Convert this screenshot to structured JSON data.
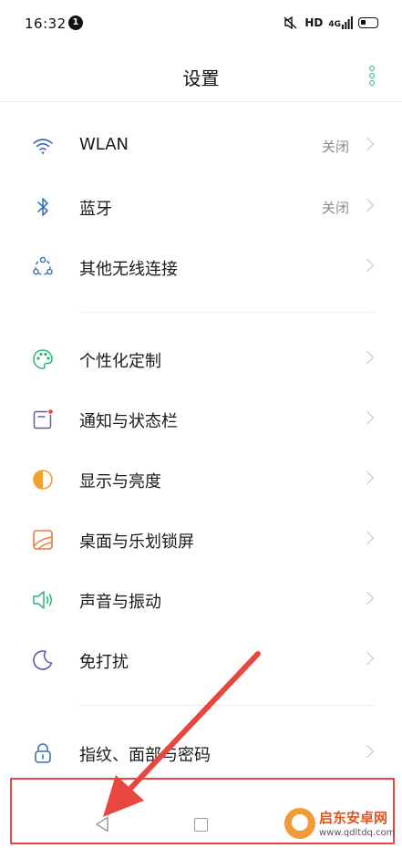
{
  "status_bar": {
    "time": "16:32",
    "notification_count": "1",
    "hd": "HD",
    "network": "4G"
  },
  "header": {
    "title": "设置"
  },
  "groups": [
    {
      "items": [
        {
          "label": "WLAN",
          "value": "关闭",
          "icon": "wifi-icon"
        },
        {
          "label": "蓝牙",
          "value": "关闭",
          "icon": "bluetooth-icon"
        },
        {
          "label": "其他无线连接",
          "value": "",
          "icon": "wireless-connections-icon"
        }
      ]
    },
    {
      "items": [
        {
          "label": "个性化定制",
          "value": "",
          "icon": "palette-icon"
        },
        {
          "label": "通知与状态栏",
          "value": "",
          "icon": "notification-icon"
        },
        {
          "label": "显示与亮度",
          "value": "",
          "icon": "brightness-icon"
        },
        {
          "label": "桌面与乐划锁屏",
          "value": "",
          "icon": "wallpaper-icon"
        },
        {
          "label": "声音与振动",
          "value": "",
          "icon": "speaker-icon"
        },
        {
          "label": "免打扰",
          "value": "",
          "icon": "moon-icon"
        }
      ]
    },
    {
      "items": [
        {
          "label": "指纹、面部与密码",
          "value": "",
          "icon": "lock-icon"
        }
      ]
    }
  ],
  "nav": {
    "back": "back-icon",
    "home": "home-icon"
  },
  "watermark": {
    "title": "启东安卓网",
    "url": "www.qdltdq.com"
  },
  "colors": {
    "accent": "#2bb673",
    "annotation": "#e8473f"
  }
}
